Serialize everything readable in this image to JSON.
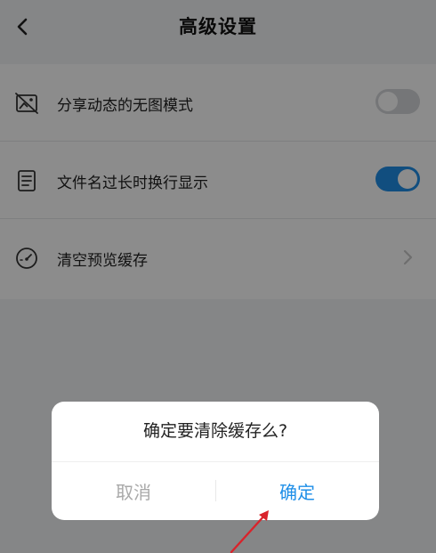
{
  "header": {
    "title": "高级设置"
  },
  "settings": {
    "items": [
      {
        "label": "分享动态的无图模式",
        "icon": "no-image-icon",
        "control": "toggle",
        "on": false
      },
      {
        "label": "文件名过长时换行显示",
        "icon": "document-lines-icon",
        "control": "toggle",
        "on": true
      },
      {
        "label": "清空预览缓存",
        "icon": "gauge-icon",
        "control": "chevron"
      }
    ]
  },
  "dialog": {
    "message": "确定要清除缓存么?",
    "cancel_label": "取消",
    "confirm_label": "确定"
  },
  "colors": {
    "accent": "#1f8fe8",
    "annotation_arrow": "#d9232b"
  }
}
